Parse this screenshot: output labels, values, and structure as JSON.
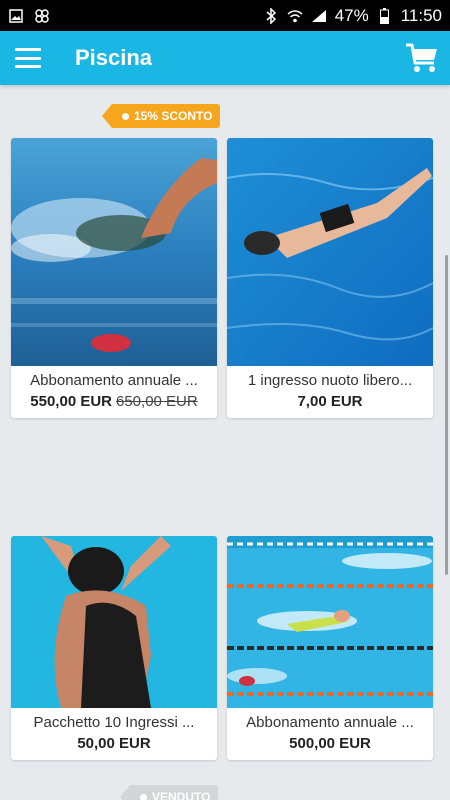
{
  "status": {
    "battery": "47%",
    "time": "11:50"
  },
  "appbar": {
    "title": "Piscina",
    "accent": "#1ab6e4"
  },
  "tags": {
    "discount": "15% SCONTO",
    "sold": "VENDUTO"
  },
  "products": [
    {
      "name": "Abbonamento annuale ...",
      "price": "550,00 EUR",
      "old_price": "650,00 EUR"
    },
    {
      "name": "1 ingresso nuoto libero...",
      "price": "7,00 EUR",
      "old_price": ""
    },
    {
      "name": "Pacchetto 10 Ingressi ...",
      "price": "50,00 EUR",
      "old_price": ""
    },
    {
      "name": "Abbonamento annuale ...",
      "price": "500,00 EUR",
      "old_price": ""
    }
  ]
}
